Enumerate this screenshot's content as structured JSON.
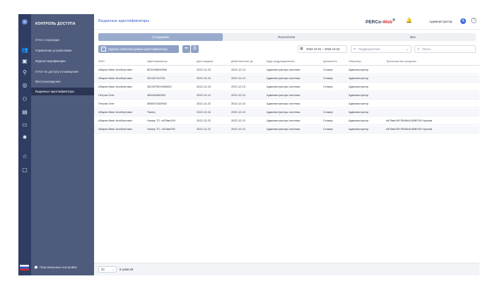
{
  "sidebar": {
    "brand": "КОНТРОЛЬ ДОСТУПА",
    "items": [
      {
        "label": "Отчет о проходах",
        "active": false
      },
      {
        "label": "Управление устройствами",
        "active": false
      },
      {
        "label": "Журнал верификации",
        "active": false
      },
      {
        "label": "Отчет по доступу в помещения",
        "active": false
      },
      {
        "label": "Местонахождение",
        "active": false
      },
      {
        "label": "Выданные идентификаторы",
        "active": true
      }
    ],
    "settings_label": "Персональные настройки",
    "rail_icons": [
      "people-icon",
      "badge-icon",
      "search-user-icon",
      "security-icon",
      "user-add-icon",
      "door-icon",
      "display-icon",
      "gear-icon",
      "star-icon",
      "chat-icon"
    ]
  },
  "header": {
    "title": "Выданные идентификаторы",
    "product_name": "PERCo-",
    "product_suffix": "Web",
    "product_mark": "®",
    "user_name": "Администратор",
    "avatar_letter": "А",
    "help_label": "?"
  },
  "tabs": [
    {
      "label": "Сотрудники",
      "active": true
    },
    {
      "label": "Посетители",
      "active": false
    },
    {
      "label": "Все",
      "active": false
    }
  ],
  "toolbar": {
    "add_label": "Удалить неиспользуемые идентификаторы",
    "date_range": "2022-12-01 – 2022-12-22",
    "department_placeholder": "Подразделение",
    "search_placeholder": "Поиск..."
  },
  "table": {
    "columns": [
      "ФИО",
      "Идентификатор",
      "Дата выдачи",
      "Действителен до",
      "Куда (подразделение)",
      "Должность",
      "Оператор",
      "Транспортное средство"
    ],
    "rows": [
      [
        "Абаров Иван Альбертович",
        "8032408045596",
        "2022-12-15",
        "2022-12-13",
        "Администраторы системы",
        "Стажер",
        "Администратор",
        ""
      ],
      [
        "Абаров Иван Альбертович",
        "332187411751",
        "2022-12-15",
        "2022-12-13",
        "Администраторы системы",
        "Стажер",
        "Администратор",
        ""
      ],
      [
        "Абаров Иван Альбертович",
        "3813975513998052",
        "2022-12-16",
        "2022-12-13",
        "Администраторы системы",
        "Стажер",
        "Администратор",
        ""
      ],
      [
        "Петров Олег",
        "465340460904",
        "2022-12-14",
        "2022-12-13",
        "Администраторы системы",
        "",
        "Администратор",
        ""
      ],
      [
        "Петров Олег",
        "5585374345942",
        "2022-12-22",
        "2022-12-13",
        "Администраторы системы",
        "",
        "Администратор",
        ""
      ],
      [
        "Абаров Иван Альбертович",
        "Палец",
        "2022-12-16",
        "2022-12-13",
        "Администраторы системы",
        "Стажер",
        "Администратор",
        ""
      ],
      [
        "Абаров Иван Альбертович",
        "Номер ТС: е876ве199",
        "2022-12-22",
        "2022-12-13",
        "Администраторы системы",
        "Стажер",
        "Администратор",
        "е876ве199 ЯМЖк014ВВ750 Hyundai"
      ],
      [
        "Абаров Иван Альбертович",
        "Номер ТС: о914вв750",
        "2022-12-22",
        "2022-12-13",
        "Администраторы системы",
        "Стажер",
        "Администратор",
        "е876ве199 ЯМЖк014ВВ750 Hyundai"
      ]
    ]
  },
  "footer": {
    "page_size": "20",
    "count_label": "8 записей"
  }
}
